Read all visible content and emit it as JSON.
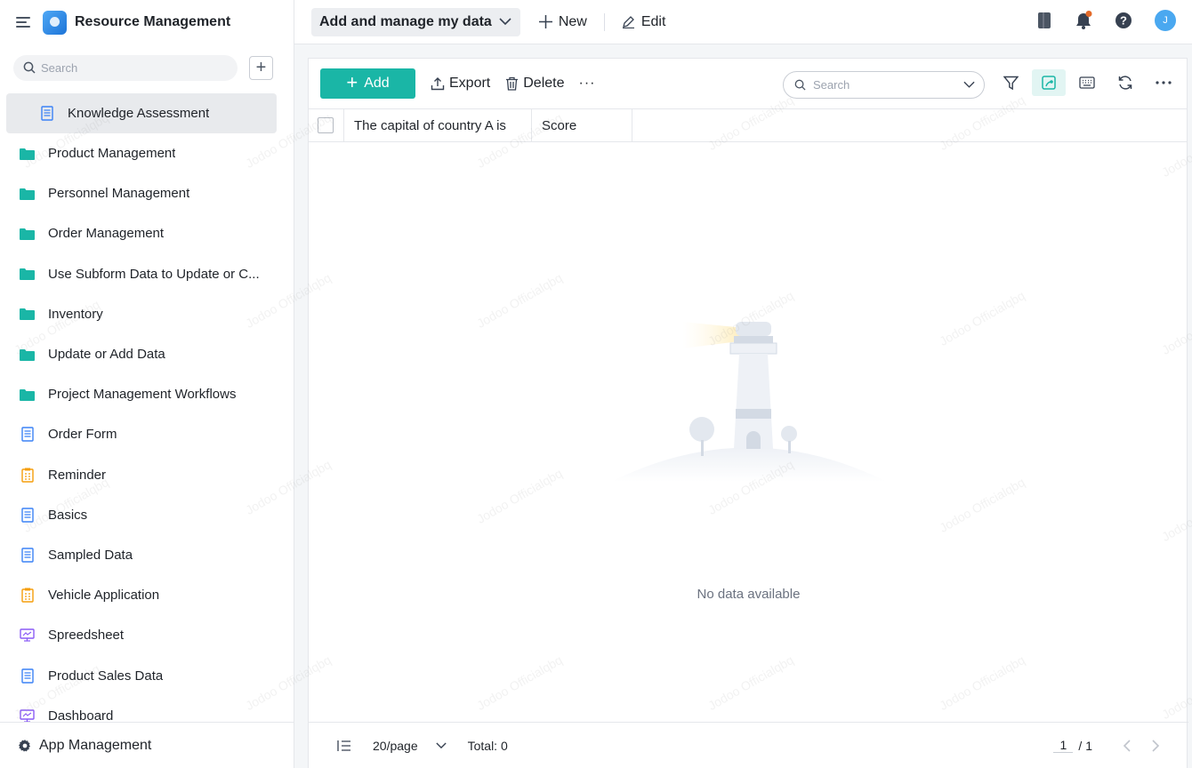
{
  "app": {
    "title": "Resource Management",
    "avatar_initial": "J"
  },
  "sidebar": {
    "search_placeholder": "Search",
    "add_symbol": "+",
    "items": [
      {
        "label": "Knowledge Assessment",
        "icon": "form-doc-icon",
        "active": true
      },
      {
        "label": "Product Management",
        "icon": "folder-icon"
      },
      {
        "label": "Personnel Management",
        "icon": "folder-icon"
      },
      {
        "label": "Order Management",
        "icon": "folder-icon"
      },
      {
        "label": "Use Subform Data to Update or C...",
        "icon": "folder-icon"
      },
      {
        "label": "Inventory",
        "icon": "folder-icon"
      },
      {
        "label": "Update or Add Data",
        "icon": "folder-icon"
      },
      {
        "label": "Project Management Workflows",
        "icon": "folder-icon"
      },
      {
        "label": "Order Form",
        "icon": "form-doc-icon"
      },
      {
        "label": "Reminder",
        "icon": "flow-form-icon"
      },
      {
        "label": "Basics",
        "icon": "form-doc-icon"
      },
      {
        "label": "Sampled Data",
        "icon": "form-doc-icon"
      },
      {
        "label": "Vehicle Application",
        "icon": "flow-form-icon"
      },
      {
        "label": "Spreedsheet",
        "icon": "dashboard-icon"
      },
      {
        "label": "Product Sales Data",
        "icon": "form-doc-icon"
      },
      {
        "label": "Dashboard",
        "icon": "dashboard-icon"
      }
    ],
    "footer_label": "App Management"
  },
  "topbar": {
    "form_title": "Add and manage my data",
    "new_label": "New",
    "edit_label": "Edit"
  },
  "toolbar": {
    "add_label": "Add",
    "export_label": "Export",
    "delete_label": "Delete",
    "more_label": "···",
    "search_placeholder": "Search"
  },
  "table": {
    "columns": [
      "The capital of country A is",
      "Score"
    ],
    "empty_text": "No data available"
  },
  "pager": {
    "page_size": "20/page",
    "total": "Total: 0",
    "current_page": "1",
    "page_count": "/ 1"
  },
  "watermark": "Jodoo Officialqbq",
  "colors": {
    "accent": "#1ab6a6",
    "folder": "#1ab6a6",
    "doc": "#3b82f6",
    "flow": "#f59e0b",
    "dash": "#8b5cf6"
  }
}
